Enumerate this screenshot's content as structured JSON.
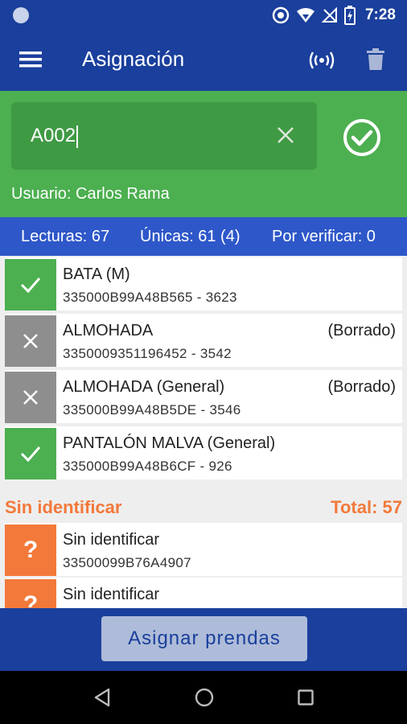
{
  "status_bar": {
    "time": "7:28"
  },
  "app_bar": {
    "title": "Asignación"
  },
  "search": {
    "value": "A002"
  },
  "user": {
    "label": "Usuario: Carlos Rama"
  },
  "stats": {
    "readings": "Lecturas: 67",
    "unique": "Únicas: 61 (4)",
    "pending": "Por verificar: 0"
  },
  "items": [
    {
      "name": "BATA (M)",
      "code": "335000B99A48B565 - 3623",
      "flag": "",
      "status": "ok"
    },
    {
      "name": "ALMOHADA",
      "code": "3350009351196452 - 3542",
      "flag": "(Borrado)",
      "status": "deleted"
    },
    {
      "name": "ALMOHADA (General)",
      "code": "335000B99A48B5DE - 3546",
      "flag": "(Borrado)",
      "status": "deleted"
    },
    {
      "name": "PANTALÓN MALVA (General)",
      "code": "335000B99A48B6CF - 926",
      "flag": "",
      "status": "ok"
    }
  ],
  "unidentified": {
    "title": "Sin identificar",
    "total": "Total: 57",
    "items": [
      {
        "name": "Sin identificar",
        "code": "33500099B76A4907",
        "badge": "?"
      },
      {
        "name": "Sin identificar",
        "code": "",
        "badge": "?"
      }
    ]
  },
  "bottom": {
    "assign_label": "Asignar prendas"
  },
  "colors": {
    "primary": "#1a3f9c",
    "green": "#4caf50",
    "stats_bar": "#2e57c9",
    "orange": "#f2793a",
    "deleted_gray": "#8e8e8e"
  }
}
